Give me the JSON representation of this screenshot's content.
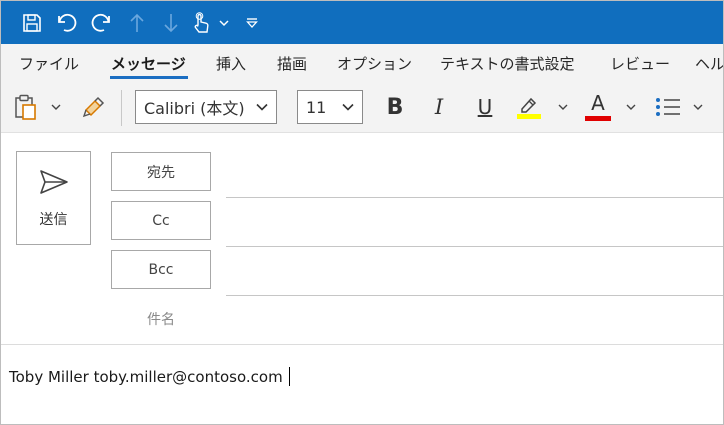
{
  "ribbon": {
    "tabs": [
      {
        "label": "ファイル"
      },
      {
        "label": "メッセージ"
      },
      {
        "label": "挿入"
      },
      {
        "label": "描画"
      },
      {
        "label": "オプション"
      },
      {
        "label": "テキストの書式設定"
      },
      {
        "label": "レビュー"
      },
      {
        "label": "ヘル"
      }
    ],
    "active_tab": "メッセージ",
    "font_name": "Calibri (本文)",
    "font_size": "11",
    "bold_label": "B",
    "italic_label": "I",
    "underline_label": "U",
    "font_color_label": "A",
    "highlight_color": "#ffff00",
    "font_color": "#e00000",
    "icons": [
      "save-icon",
      "undo-icon",
      "redo-icon",
      "up-arrow-icon",
      "down-arrow-icon",
      "touch-mode-icon",
      "customize-qat-icon",
      "paste-icon",
      "format-painter-icon",
      "highlight-icon",
      "font-color-icon",
      "bullets-icon"
    ]
  },
  "compose": {
    "send_label": "送信",
    "to_label": "宛先",
    "cc_label": "Cc",
    "bcc_label": "Bcc",
    "subject_label": "件名",
    "body_text": "Toby Miller toby.miller@contoso.com"
  },
  "colors": {
    "titlebar": "#106ebe",
    "ribbon_bg": "#f3f3f3",
    "accent": "#1b6ec2"
  }
}
